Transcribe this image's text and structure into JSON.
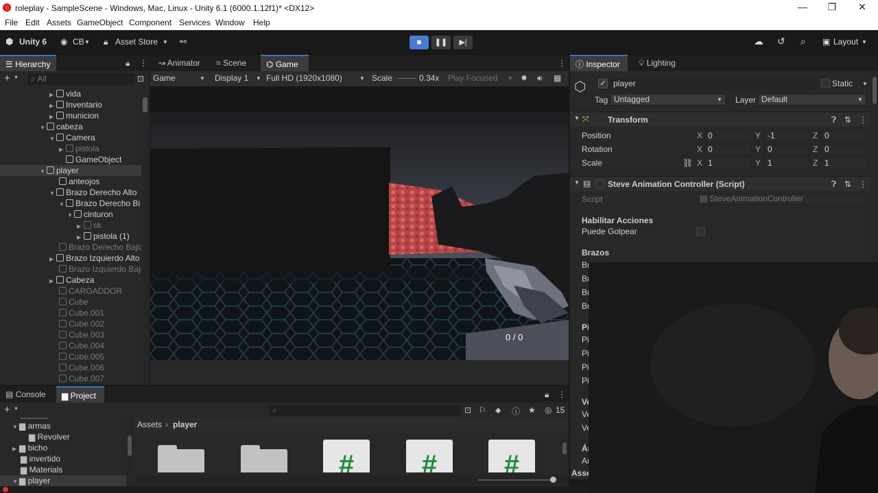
{
  "window": {
    "title": "roleplay - SampleScene - Windows, Mac, Linux - Unity 6.1 (6000.1.12f1)* <DX12>",
    "minimize": "—",
    "maximize": "❐",
    "close": "✕"
  },
  "menu": [
    "File",
    "Edit",
    "Assets",
    "GameObject",
    "Component",
    "Services",
    "Window",
    "Help"
  ],
  "toolbar": {
    "unity_label": "Unity 6",
    "account_label": "CB",
    "asset_store_label": "Asset Store",
    "layout_label": "Layout",
    "play_state": "playing"
  },
  "hierarchy": {
    "tab": "Hierarchy",
    "search_placeholder": "All",
    "items": [
      {
        "label": "vida",
        "dim": false
      },
      {
        "label": "Inventario",
        "dim": false
      },
      {
        "label": "municion",
        "dim": false
      },
      {
        "label": "cabeza",
        "dim": false
      },
      {
        "label": "Camera",
        "dim": false
      },
      {
        "label": "pistola",
        "dim": true
      },
      {
        "label": "GameObject",
        "dim": false
      },
      {
        "label": "player",
        "dim": false
      },
      {
        "label": "anteojos",
        "dim": false
      },
      {
        "label": "Brazo Derecho Alto",
        "dim": false
      },
      {
        "label": "Brazo Derecho Bi",
        "dim": false
      },
      {
        "label": "cinturon",
        "dim": false
      },
      {
        "label": "sk",
        "dim": true
      },
      {
        "label": "pistola (1)",
        "dim": false
      },
      {
        "label": "Brazo Derecho Bajo",
        "dim": true
      },
      {
        "label": "Brazo Izquierdo Alto",
        "dim": false
      },
      {
        "label": "Brazo Izquierdo Bajo",
        "dim": true
      },
      {
        "label": "Cabeza",
        "dim": false
      },
      {
        "label": "CARGADDOR",
        "dim": true
      },
      {
        "label": "Cube",
        "dim": true
      },
      {
        "label": "Cube.001",
        "dim": true
      },
      {
        "label": "Cube.002",
        "dim": true
      },
      {
        "label": "Cube.003",
        "dim": true
      },
      {
        "label": "Cube.004",
        "dim": true
      },
      {
        "label": "Cube.005",
        "dim": true
      },
      {
        "label": "Cube.006",
        "dim": true
      },
      {
        "label": "Cube.007",
        "dim": true
      }
    ]
  },
  "center_tabs": {
    "animator": "Animator",
    "scene": "Scene",
    "game": "Game"
  },
  "game_toolbar": {
    "mode": "Game",
    "display": "Display 1",
    "resolution": "Full HD (1920x1080)",
    "scale_label": "Scale",
    "scale_value": "0.34x",
    "play_focused": "Play Focused"
  },
  "game_view": {
    "ammo": "0 / 0"
  },
  "inspector": {
    "tab": "Inspector",
    "lighting_tab": "Lighting",
    "object_name": "player",
    "static_label": "Static",
    "tag_label": "Tag",
    "tag_value": "Untagged",
    "layer_label": "Layer",
    "layer_value": "Default",
    "transform": {
      "title": "Transform",
      "position_label": "Position",
      "rotation_label": "Rotation",
      "scale_label": "Scale",
      "position": [
        "0",
        "-1",
        "0"
      ],
      "rotation": [
        "0",
        "0",
        "0"
      ],
      "scale": [
        "1",
        "1",
        "1"
      ]
    },
    "script_component": {
      "title": "Steve Animation Controller (Script)",
      "script_label": "Script",
      "script_value": "SteveAnimationController",
      "section1": "Habilitar Acciones",
      "field1": "Puede Golpear",
      "section2": "Brazos",
      "partial_rows": [
        "Br",
        "Br",
        "Br",
        "Br"
      ],
      "section3": "Pi",
      "partial_rows2": [
        "Pi",
        "Pi",
        "Pi",
        "Pi"
      ],
      "section4": "Ve",
      "partial_rows3": [
        "Ve",
        "Ve"
      ],
      "section5": "Ár",
      "partial_rows4": [
        "Ar"
      ]
    },
    "footer": "Asse"
  },
  "bottom": {
    "console_tab": "Console",
    "project_tab": "Project",
    "badge_count": "15",
    "breadcrumb_root": "Assets",
    "breadcrumb_current": "player",
    "folders": [
      {
        "label": "armas",
        "indent": 1
      },
      {
        "label": "Revolver",
        "indent": 2
      },
      {
        "label": "bicho",
        "indent": 1
      },
      {
        "label": "invertido",
        "indent": 1
      },
      {
        "label": "Materials",
        "indent": 1
      },
      {
        "label": "player",
        "indent": 1
      }
    ]
  }
}
